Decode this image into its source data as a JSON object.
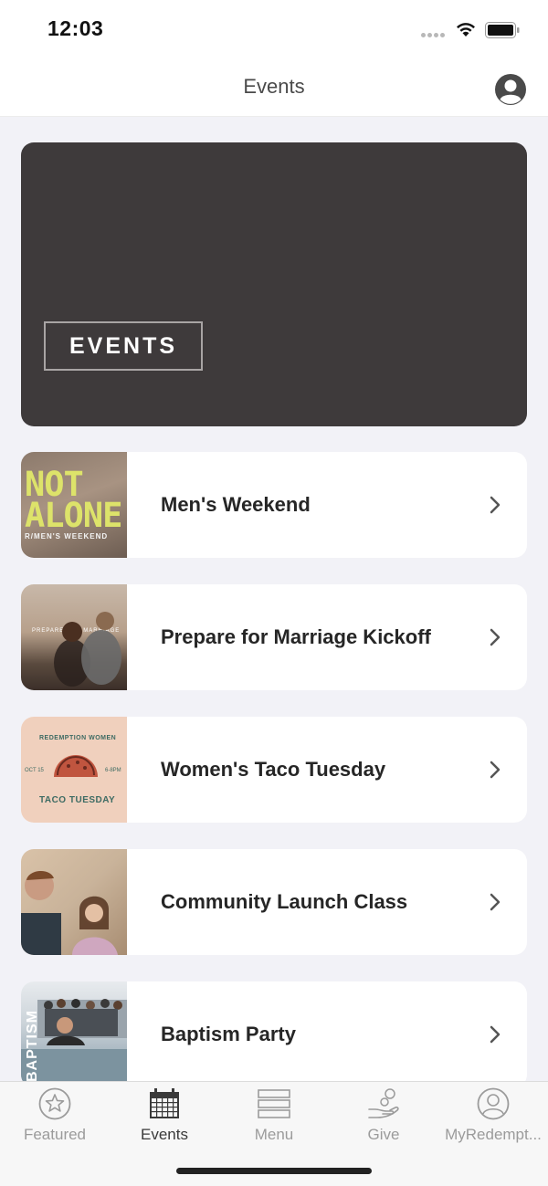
{
  "status_bar": {
    "time": "12:03"
  },
  "nav": {
    "title": "Events"
  },
  "hero": {
    "badge_text": "EVENTS"
  },
  "events": [
    {
      "title": "Men's Weekend",
      "thumb_text_1": "NOT",
      "thumb_text_2": "ALONE",
      "thumb_caption": "R/MEN'S WEEKEND"
    },
    {
      "title": "Prepare for Marriage Kickoff",
      "thumb_caption": "PREPARE FOR MARRIAGE"
    },
    {
      "title": "Women's Taco Tuesday",
      "thumb_top": "REDEMPTION WOMEN",
      "thumb_bottom": "TACO TUESDAY",
      "thumb_left": "OCT 15",
      "thumb_right": "6-8PM"
    },
    {
      "title": "Community Launch Class"
    },
    {
      "title": "Baptism Party",
      "thumb_caption": "BAPTISM"
    }
  ],
  "tabs": [
    {
      "label": "Featured",
      "icon": "star-icon",
      "active": false
    },
    {
      "label": "Events",
      "icon": "calendar-icon",
      "active": true
    },
    {
      "label": "Menu",
      "icon": "menu-icon",
      "active": false
    },
    {
      "label": "Give",
      "icon": "give-icon",
      "active": false
    },
    {
      "label": "MyRedempt...",
      "icon": "profile-icon",
      "active": false
    }
  ],
  "colors": {
    "hero_bg": "#3e3a3b",
    "background": "#f2f2f7",
    "taco_accent": "#c0553f"
  }
}
